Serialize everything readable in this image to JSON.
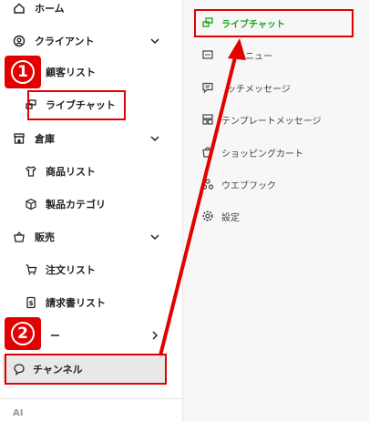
{
  "sidebar": {
    "home": "ホーム",
    "client": "クライアント",
    "customer_list": "顧客リスト",
    "live_chat": "ライブチャット",
    "warehouse": "倉庫",
    "product_list": "商品リスト",
    "product_category": "製品カテゴリ",
    "sales": "販売",
    "order_list": "注文リスト",
    "invoice_list": "請求書リスト",
    "hidden_item": "ー",
    "channel": "チャンネル",
    "ai_label": "AI"
  },
  "submenu": {
    "items": [
      {
        "label": "ライブチャット",
        "icon": "chat-bubbles-icon",
        "selected": true
      },
      {
        "label": "メニュー",
        "icon": "menu-dots-icon"
      },
      {
        "label": "ッチメッセージ",
        "icon": "message-icon"
      },
      {
        "label": "テンプレートメッセージ",
        "icon": "template-icon"
      },
      {
        "label": "ショッピングカート",
        "icon": "cart-icon"
      },
      {
        "label": "ウエブフック",
        "icon": "webhook-icon"
      },
      {
        "label": "設定",
        "icon": "gear-icon"
      }
    ]
  },
  "annotations": {
    "badge_1": "1",
    "badge_2": "2",
    "color": "#e30000"
  },
  "colors": {
    "accent_green": "#19a61e",
    "active_bg": "#e8e8e8"
  }
}
